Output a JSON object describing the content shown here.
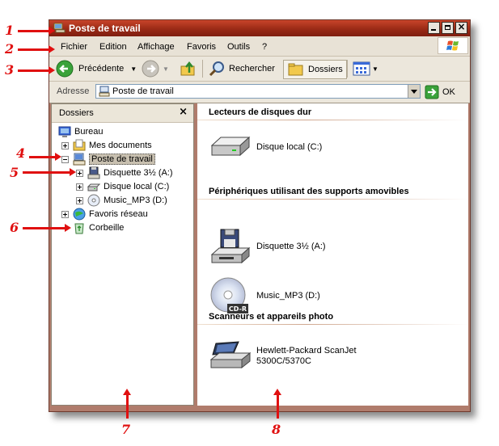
{
  "window": {
    "title": "Poste de travail"
  },
  "menu": [
    "Fichier",
    "Edition",
    "Affichage",
    "Favoris",
    "Outils",
    "?"
  ],
  "toolbar": {
    "back_label": "Précédente",
    "search_label": "Rechercher",
    "folders_label": "Dossiers"
  },
  "address": {
    "label": "Adresse",
    "value": "Poste de travail",
    "go_label": "OK"
  },
  "leftpane": {
    "title": "Dossiers",
    "close": "×",
    "tree": [
      "Bureau",
      "Mes documents",
      "Poste de travail",
      "Disquette 3½ (A:)",
      "Disque local (C:)",
      "Music_MP3 (D:)",
      "Favoris réseau",
      "Corbeille"
    ]
  },
  "rightpane": {
    "groups": [
      {
        "title": "Lecteurs de disques dur",
        "items": [
          "Disque local (C:)"
        ]
      },
      {
        "title": "Périphériques utilisant des supports amovibles",
        "items": [
          "Disquette 3½ (A:)",
          "Music_MP3 (D:)"
        ]
      },
      {
        "title": "Scanneurs et appareils photo",
        "items": [
          "Hewlett-Packard ScanJet 5300C/5370C"
        ]
      }
    ]
  },
  "cdr_label": "CD-R",
  "annotations": [
    "1",
    "2",
    "3",
    "4",
    "5",
    "6",
    "7",
    "8"
  ],
  "colors": {
    "title_bar": "#9a2a16",
    "annotation": "#e01010",
    "selection": "#c8c0b0"
  }
}
